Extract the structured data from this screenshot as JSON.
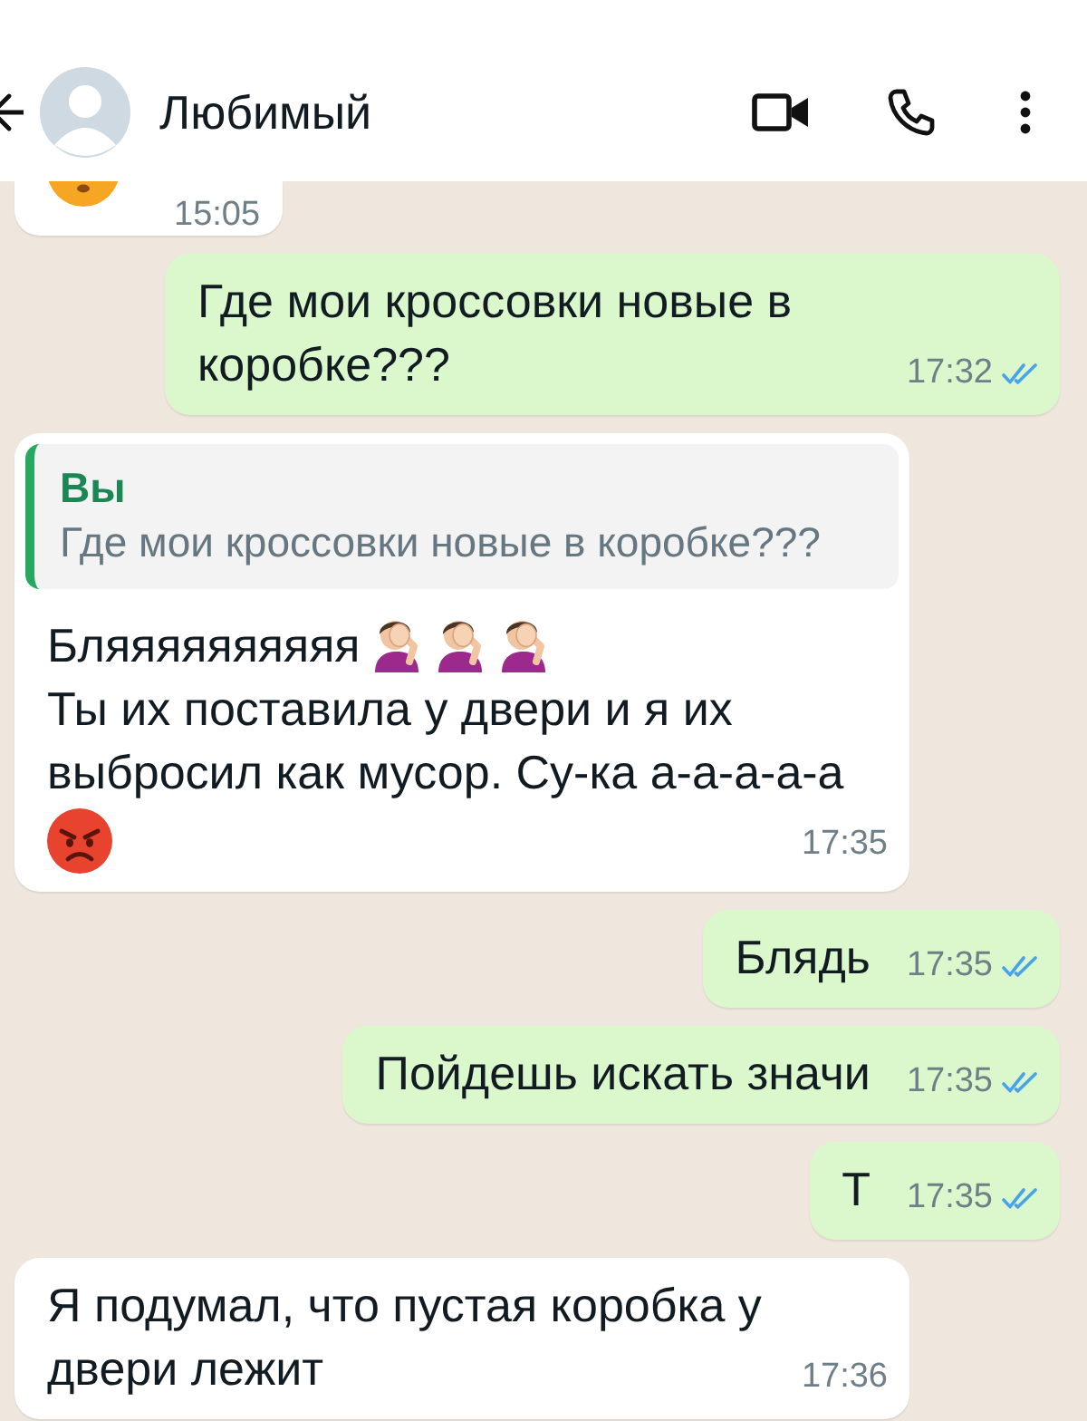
{
  "header": {
    "contact_name": "Любимый"
  },
  "messages": [
    {
      "kind": "incoming",
      "blocks": [
        {
          "emojis": [
            {
              "kind": "smiley"
            }
          ]
        }
      ],
      "time": "15:05"
    },
    {
      "kind": "outgoing",
      "blocks": [
        {
          "text": "Где мои кроссовки новые в коробке???"
        }
      ],
      "time": "17:32",
      "read": true
    },
    {
      "kind": "incoming",
      "reply": {
        "author": "Вы",
        "text": "Где мои кроссовки новые в коробке???"
      },
      "blocks": [
        {
          "text": "Бляяяяяяяяяя",
          "emojis": [
            {
              "kind": "facepalm"
            },
            {
              "kind": "facepalm"
            },
            {
              "kind": "facepalm"
            }
          ]
        },
        {
          "text": "Ты их поставила у двери и я их выбросил как мусор. Су-ка а-а-а-а-а"
        },
        {
          "emojis": [
            {
              "kind": "angry"
            }
          ]
        }
      ],
      "time": "17:35"
    },
    {
      "kind": "outgoing",
      "blocks": [
        {
          "text": "Блядь"
        }
      ],
      "time": "17:35",
      "read": true
    },
    {
      "kind": "outgoing",
      "blocks": [
        {
          "text": "Пойдешь искать значи"
        }
      ],
      "time": "17:35",
      "read": true
    },
    {
      "kind": "outgoing",
      "blocks": [
        {
          "text": "Т"
        }
      ],
      "time": "17:35",
      "read": true
    },
    {
      "kind": "incoming",
      "blocks": [
        {
          "text": "Я подумал, что пустая коробка у двери лежит"
        }
      ],
      "time": "17:36"
    }
  ]
}
